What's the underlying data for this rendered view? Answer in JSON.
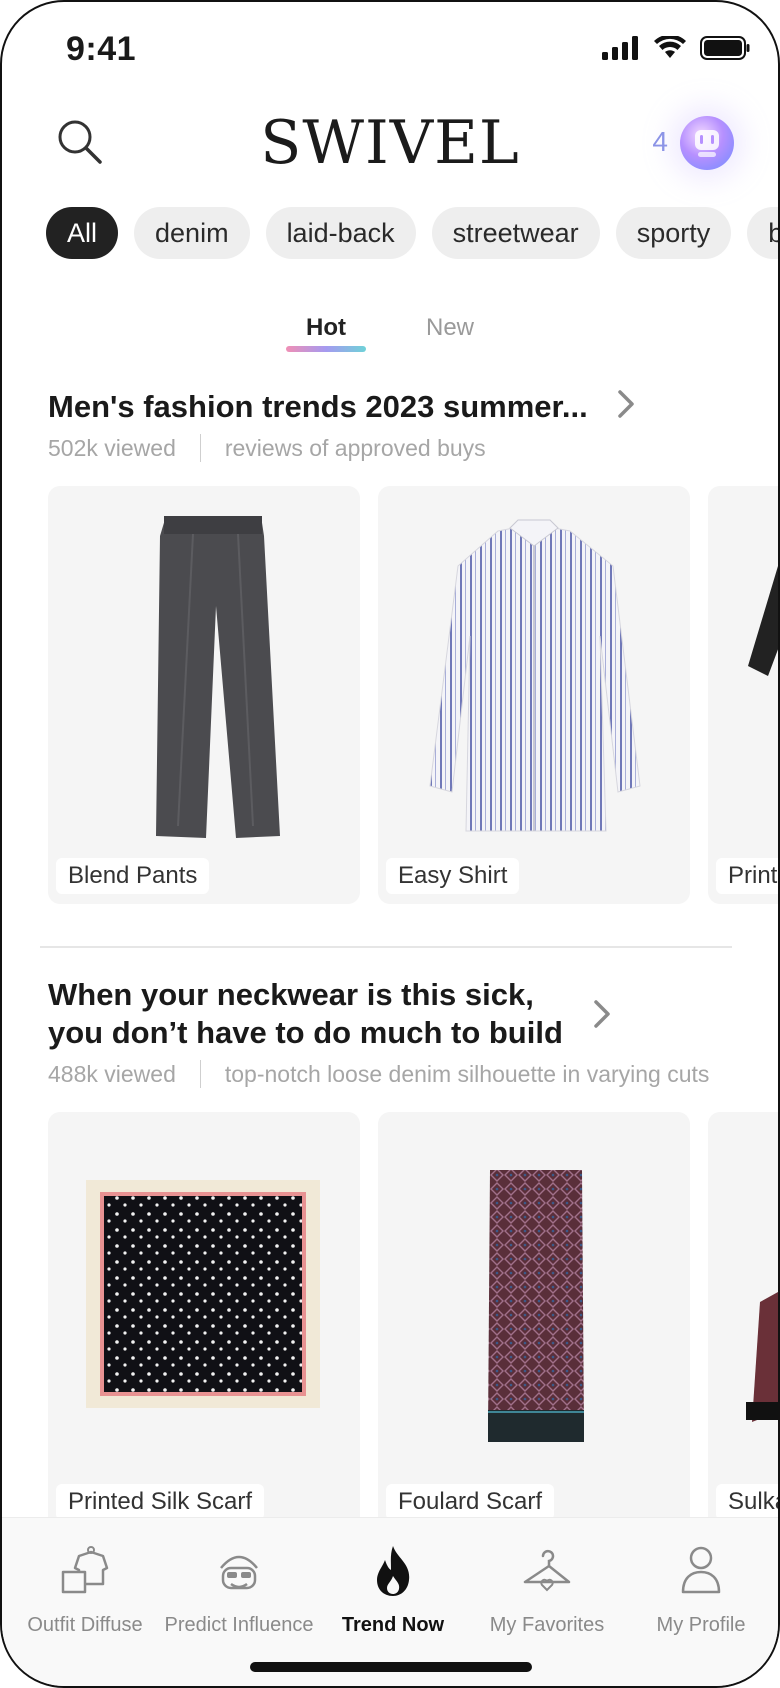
{
  "status_bar": {
    "time": "9:41"
  },
  "header": {
    "logo": "SWIVEL",
    "credits": "4"
  },
  "chips": [
    "All",
    "denim",
    "laid-back",
    "streetwear",
    "sporty",
    "b"
  ],
  "tabs": [
    "Hot",
    "New"
  ],
  "sections": [
    {
      "title": "Men's fashion trends 2023 summer...",
      "views": "502k viewed",
      "tagline": "reviews of approved buys",
      "items": [
        "Blend Pants",
        "Easy Shirt",
        "Printe"
      ]
    },
    {
      "title_line1": "When your neckwear is this sick,",
      "title_line2": "you don’t have to do much to build",
      "views": "488k viewed",
      "tagline": "top-notch loose denim silhouette in varying cuts",
      "items": [
        "Printed Silk Scarf",
        "Foulard Scarf",
        "Sulka"
      ]
    }
  ],
  "bottom_nav": [
    {
      "label": "Outfit Diffuse",
      "icon": "outfit-diffuse-icon"
    },
    {
      "label": "Predict Influence",
      "icon": "predict-influence-icon"
    },
    {
      "label": "Trend Now",
      "icon": "flame-icon",
      "active": true
    },
    {
      "label": "My Favorites",
      "icon": "hanger-heart-icon"
    },
    {
      "label": "My Profile",
      "icon": "person-icon"
    }
  ],
  "colors": {
    "accent_credit": "#8a93e6",
    "chip_active_bg": "#222222",
    "tab_underline": [
      "#f08fb5",
      "#a59af0",
      "#6fd2d8"
    ]
  }
}
